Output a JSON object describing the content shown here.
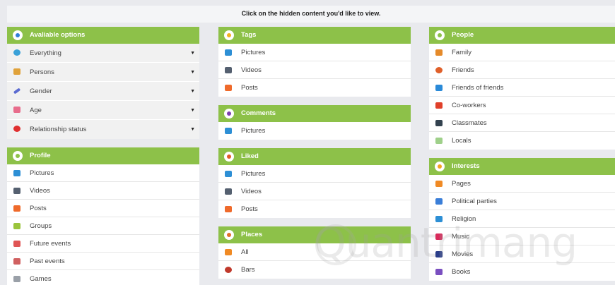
{
  "header": {
    "instruction": "Click on the hidden content you'd like to view."
  },
  "colors": {
    "accent": "#8dc149",
    "background": "#e9eaee"
  },
  "available_options": {
    "title": "Avaliable options",
    "icon": "info-icon",
    "items": [
      {
        "label": "Everything",
        "icon": "clock-icon"
      },
      {
        "label": "Persons",
        "icon": "persons-icon"
      },
      {
        "label": "Gender",
        "icon": "pen-icon"
      },
      {
        "label": "Age",
        "icon": "cake-icon"
      },
      {
        "label": "Relationship status",
        "icon": "heart-icon"
      }
    ]
  },
  "profile": {
    "title": "Profile",
    "icon": "person-icon",
    "items": [
      {
        "label": "Pictures",
        "icon": "camera-icon"
      },
      {
        "label": "Videos",
        "icon": "video-icon"
      },
      {
        "label": "Posts",
        "icon": "posts-icon"
      },
      {
        "label": "Groups",
        "icon": "groups-icon"
      },
      {
        "label": "Future events",
        "icon": "calendar-icon"
      },
      {
        "label": "Past events",
        "icon": "calendar-icon"
      },
      {
        "label": "Games",
        "icon": "games-icon"
      }
    ]
  },
  "tags": {
    "title": "Tags",
    "icon": "tag-icon",
    "items": [
      {
        "label": "Pictures",
        "icon": "camera-icon"
      },
      {
        "label": "Videos",
        "icon": "video-icon"
      },
      {
        "label": "Posts",
        "icon": "posts-icon"
      }
    ]
  },
  "comments": {
    "title": "Comments",
    "icon": "comment-icon",
    "items": [
      {
        "label": "Pictures",
        "icon": "flag-icon"
      }
    ]
  },
  "liked": {
    "title": "Liked",
    "icon": "like-icon",
    "items": [
      {
        "label": "Pictures",
        "icon": "camera-icon"
      },
      {
        "label": "Videos",
        "icon": "video-icon"
      },
      {
        "label": "Posts",
        "icon": "posts-icon"
      }
    ]
  },
  "places": {
    "title": "Places",
    "icon": "pin-icon",
    "items": [
      {
        "label": "All",
        "icon": "cocktail-icon"
      },
      {
        "label": "Bars",
        "icon": "bar-icon"
      }
    ]
  },
  "people": {
    "title": "People",
    "icon": "people-icon",
    "items": [
      {
        "label": "Family",
        "icon": "family-icon"
      },
      {
        "label": "Friends",
        "icon": "friends-icon"
      },
      {
        "label": "Friends of friends",
        "icon": "friends-of-friends-icon"
      },
      {
        "label": "Co-workers",
        "icon": "briefcase-icon"
      },
      {
        "label": "Classmates",
        "icon": "graduation-cap-icon"
      },
      {
        "label": "Locals",
        "icon": "map-icon"
      }
    ]
  },
  "interests": {
    "title": "Interests",
    "icon": "star-icon",
    "items": [
      {
        "label": "Pages",
        "icon": "cocktail-icon"
      },
      {
        "label": "Political parties",
        "icon": "parties-icon"
      },
      {
        "label": "Religion",
        "icon": "religion-icon"
      },
      {
        "label": "Music",
        "icon": "music-icon"
      },
      {
        "label": "Movies",
        "icon": "movie-icon"
      },
      {
        "label": "Books",
        "icon": "book-icon"
      }
    ]
  },
  "watermark": {
    "text": "Quantrimang"
  }
}
